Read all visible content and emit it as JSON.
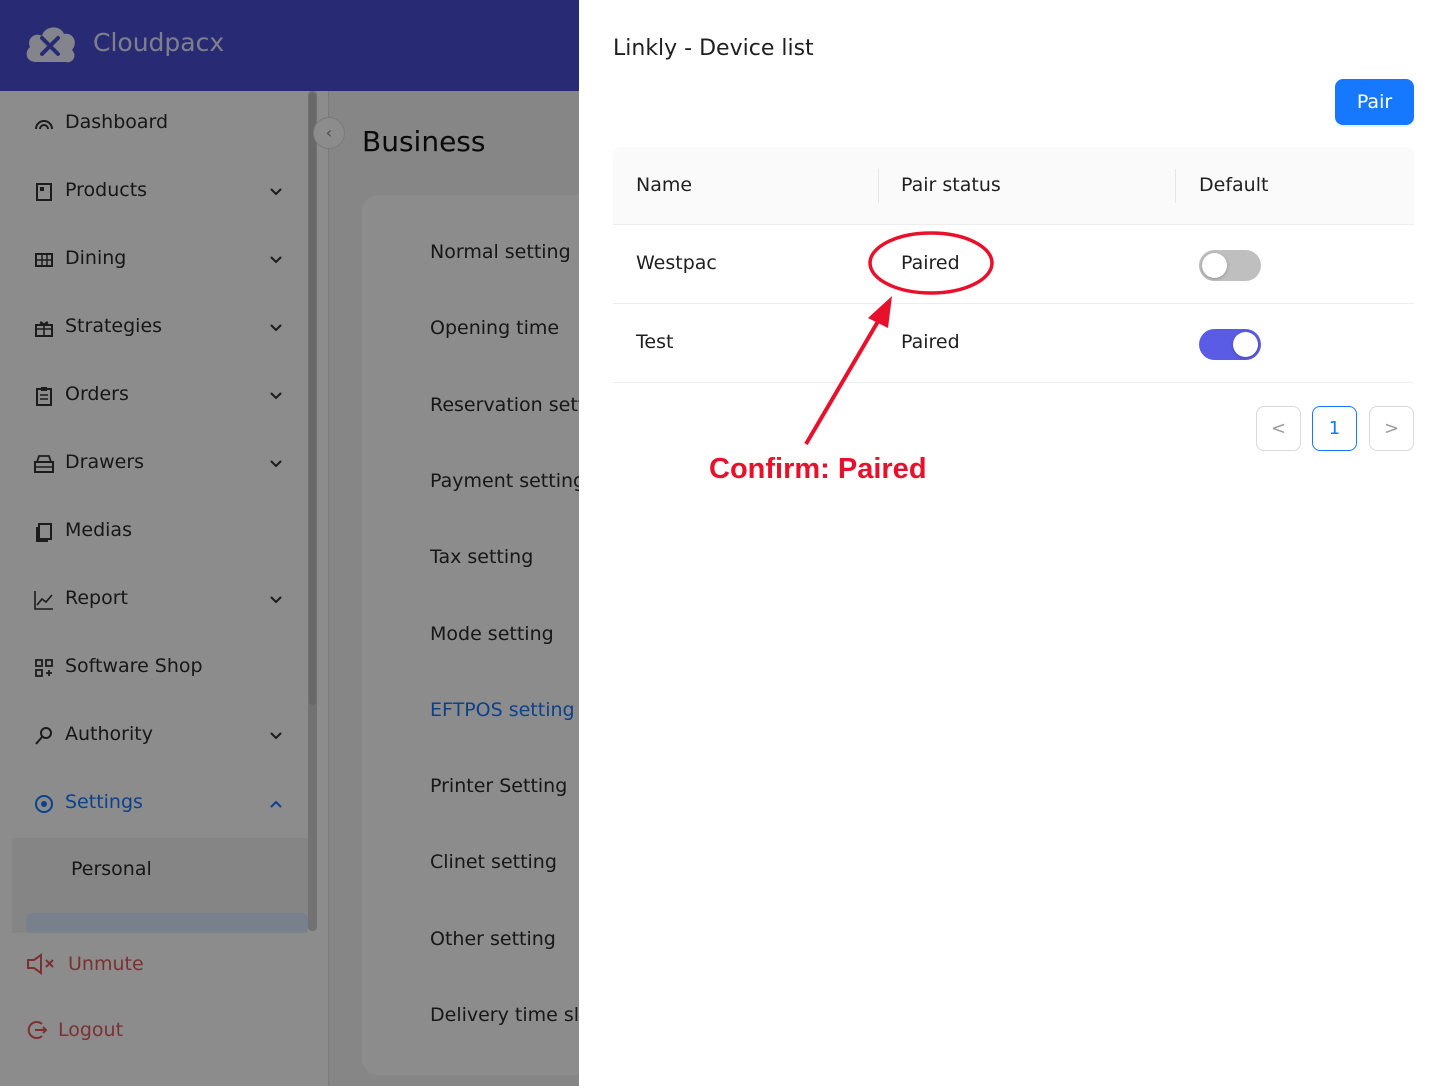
{
  "app": {
    "brand": "Cloudpacx",
    "sidebar": {
      "items": [
        {
          "label": "Dashboard",
          "icon": "dashboard-icon",
          "has_chevron": false
        },
        {
          "label": "Products",
          "icon": "products-icon",
          "has_chevron": true
        },
        {
          "label": "Dining",
          "icon": "dining-icon",
          "has_chevron": true
        },
        {
          "label": "Strategies",
          "icon": "gift-icon",
          "has_chevron": true
        },
        {
          "label": "Orders",
          "icon": "clipboard-icon",
          "has_chevron": true
        },
        {
          "label": "Drawers",
          "icon": "drawer-icon",
          "has_chevron": true
        },
        {
          "label": "Medias",
          "icon": "media-icon",
          "has_chevron": false
        },
        {
          "label": "Report",
          "icon": "chart-icon",
          "has_chevron": true
        },
        {
          "label": "Software Shop",
          "icon": "apps-icon",
          "has_chevron": false
        },
        {
          "label": "Authority",
          "icon": "key-icon",
          "has_chevron": true
        },
        {
          "label": "Settings",
          "icon": "settings-icon",
          "has_chevron": true,
          "active": true,
          "expanded": true
        }
      ],
      "submenu": [
        "Personal"
      ],
      "unmute": "Unmute",
      "logout": "Logout"
    },
    "main": {
      "title": "Business",
      "settings": [
        "Normal setting",
        "Opening time",
        "Reservation setti",
        "Payment setting",
        "Tax setting",
        "Mode setting",
        "EFTPOS setting",
        "Printer Setting",
        "Clinet setting",
        "Other setting",
        "Delivery time slo"
      ],
      "active_setting": "EFTPOS setting"
    }
  },
  "drawer": {
    "title": "Linkly - Device list",
    "pair_button": "Pair",
    "table": {
      "headers": [
        "Name",
        "Pair status",
        "Default"
      ],
      "rows": [
        {
          "name": "Westpac",
          "status": "Paired",
          "default": false
        },
        {
          "name": "Test",
          "status": "Paired",
          "default": true
        }
      ]
    },
    "pagination": {
      "prev": "<",
      "current": "1",
      "next": ">"
    }
  },
  "annotation": {
    "text": "Confirm: Paired",
    "color": "#e8102a"
  },
  "colors": {
    "topbar": "#4a4fd3",
    "primary": "#1677ff",
    "switch_on": "#5b5ce6",
    "danger": "#e05a5a"
  }
}
